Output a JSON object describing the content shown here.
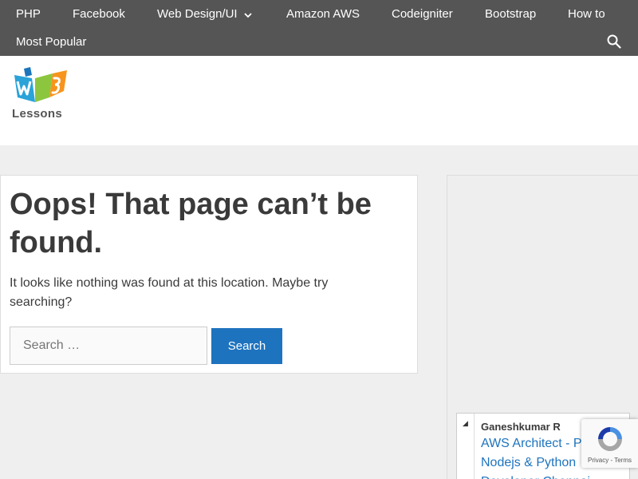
{
  "nav": {
    "items": [
      {
        "label": "PHP"
      },
      {
        "label": "Facebook"
      },
      {
        "label": "Web Design/UI"
      },
      {
        "label": "Amazon AWS"
      },
      {
        "label": "Codeigniter"
      },
      {
        "label": "Bootstrap"
      },
      {
        "label": "How to"
      },
      {
        "label": "Most Popular"
      }
    ],
    "search_icon": "search-icon"
  },
  "header": {
    "logo_text": "Lessons",
    "logo_icon": "w3-book-icon"
  },
  "main": {
    "title": "Oops! That page can’t be found.",
    "message": "It looks like nothing was found at this location. Maybe try searching?",
    "search_placeholder": "Search …",
    "search_button": "Search"
  },
  "sidebar": {
    "profile": {
      "name": "Ganeshkumar R",
      "description": "AWS Architect - PHP, Nodejs & Python Developer Chennai"
    }
  },
  "recaptcha": {
    "privacy": "Privacy",
    "separator": " - ",
    "terms": "Terms"
  },
  "colors": {
    "nav_bg": "#555555",
    "accent": "#1e73be",
    "page_bg": "#efefef"
  }
}
